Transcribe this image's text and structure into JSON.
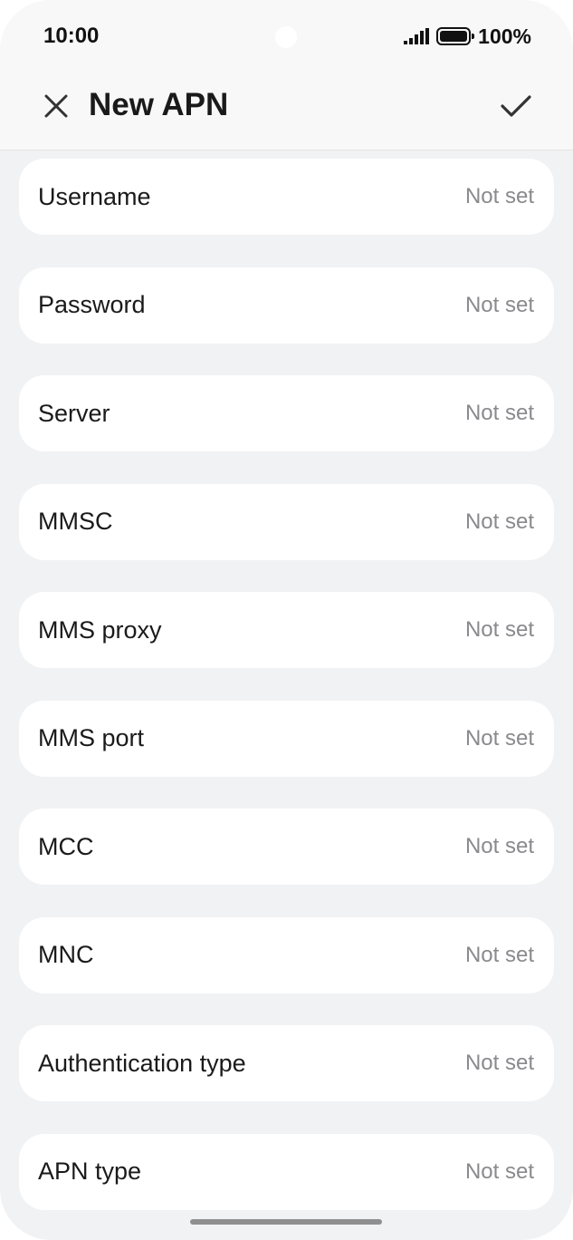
{
  "status_bar": {
    "time": "10:00",
    "battery_percent": "100%",
    "signal_icon": "signal-bars-icon",
    "battery_icon": "battery-icon"
  },
  "header": {
    "title": "New APN",
    "close_icon": "close-icon",
    "confirm_icon": "checkmark-icon"
  },
  "fields": [
    {
      "label": "Username",
      "value": "Not set"
    },
    {
      "label": "Password",
      "value": "Not set"
    },
    {
      "label": "Server",
      "value": "Not set"
    },
    {
      "label": "MMSC",
      "value": "Not set"
    },
    {
      "label": "MMS proxy",
      "value": "Not set"
    },
    {
      "label": "MMS port",
      "value": "Not set"
    },
    {
      "label": "MCC",
      "value": "Not set"
    },
    {
      "label": "MNC",
      "value": "Not set"
    },
    {
      "label": "Authentication type",
      "value": "Not set"
    },
    {
      "label": "APN type",
      "value": "Not set"
    }
  ],
  "colors": {
    "background": "#f1f2f4",
    "card": "#ffffff",
    "secondary_text": "#8a8a8e"
  }
}
